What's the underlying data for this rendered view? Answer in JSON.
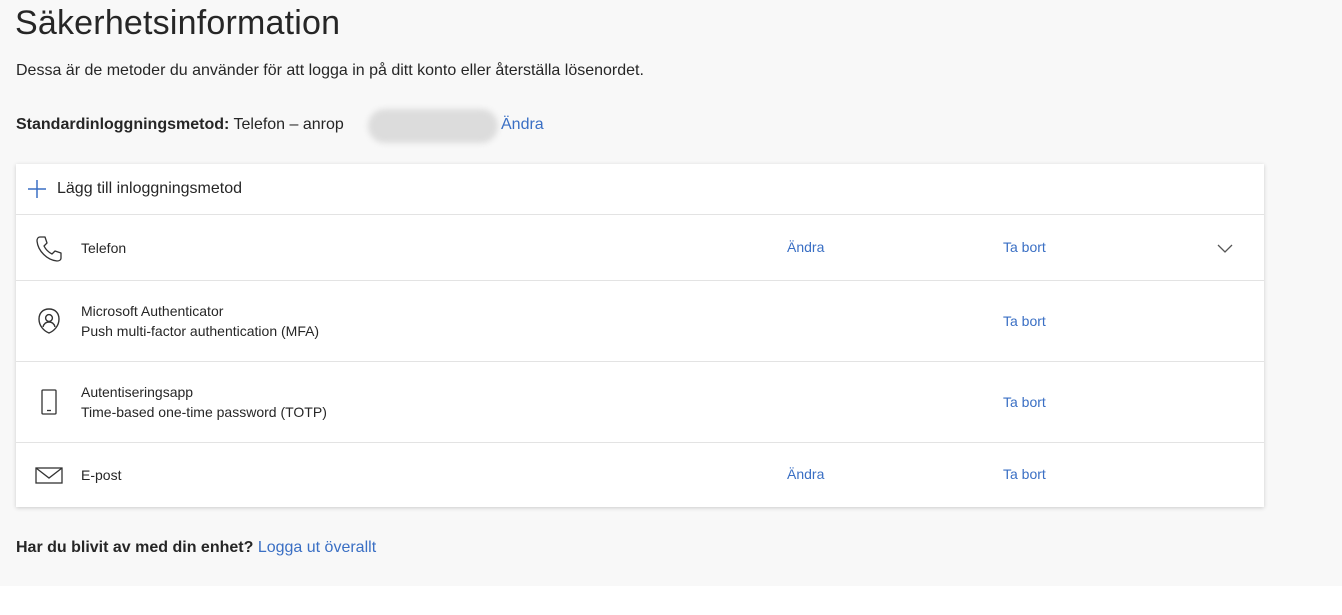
{
  "header": {
    "title": "Säkerhetsinformation",
    "subtitle": "Dessa är de metoder du använder för att logga in på ditt konto eller återställa lösenordet."
  },
  "default_method": {
    "label": "Standardinloggningsmetod:",
    "value": "Telefon – anrop",
    "change_label": "Ändra"
  },
  "methods_panel": {
    "add_label": "Lägg till inloggningsmetod",
    "rows": [
      {
        "name": "Telefon",
        "detail": "",
        "change_label": "Ändra",
        "remove_label": "Ta bort",
        "icon": "phone-icon"
      },
      {
        "name": "Microsoft Authenticator",
        "detail": "Push multi-factor authentication (MFA)",
        "change_label": "",
        "remove_label": "Ta bort",
        "icon": "authenticator-icon"
      },
      {
        "name": "Autentiseringsapp",
        "detail": "Time-based one-time password (TOTP)",
        "change_label": "",
        "remove_label": "Ta bort",
        "icon": "mobile-device-icon"
      },
      {
        "name": "E-post",
        "detail": "",
        "change_label": "Ändra",
        "remove_label": "Ta bort",
        "icon": "mail-icon"
      }
    ]
  },
  "footer": {
    "question": "Har du blivit av med din enhet?",
    "link_label": "Logga ut överallt"
  },
  "colors": {
    "link": "#3a6fc4",
    "page_bg": "#f8f8f8",
    "card_bg": "#ffffff",
    "divider": "#e3e3e3"
  }
}
